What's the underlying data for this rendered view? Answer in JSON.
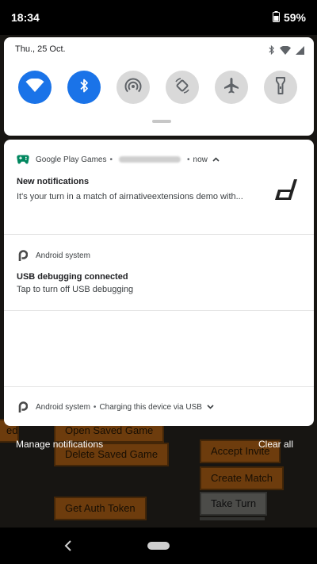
{
  "status_bar": {
    "time": "18:34",
    "battery": "59%"
  },
  "quick_settings": {
    "date": "Thu., 25 Oct.",
    "tiles": [
      {
        "name": "wifi",
        "on": true
      },
      {
        "name": "bluetooth",
        "on": true
      },
      {
        "name": "hotspot",
        "on": false
      },
      {
        "name": "auto-rotate",
        "on": false
      },
      {
        "name": "airplane",
        "on": false
      },
      {
        "name": "flashlight",
        "on": false
      }
    ]
  },
  "notifications": [
    {
      "app": "Google Play Games",
      "time": "now",
      "title": "New notifications",
      "body": "It's your turn in a match of airnativeextensions demo with..."
    },
    {
      "app": "Android system",
      "title": "USB debugging connected",
      "body": "Tap to turn off USB debugging"
    },
    {
      "app": "Android system",
      "summary": "Charging this device via USB"
    }
  ],
  "actions": {
    "manage": "Manage notifications",
    "clear_all": "Clear all"
  },
  "background_app": {
    "buttons": [
      "Open Saved Game",
      "Delete Saved Game",
      "Get Auth Token",
      "Accept Invite",
      "Create Match",
      "Take Turn"
    ]
  },
  "colors": {
    "accent": "#1a73e8",
    "play_games_green": "#01875f",
    "app_orange": "#c76e18"
  }
}
